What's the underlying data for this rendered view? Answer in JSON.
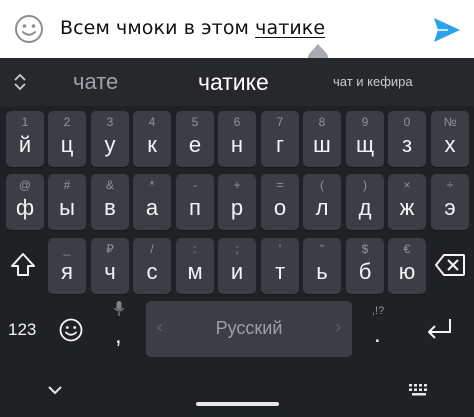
{
  "input_bar": {
    "emoji_icon": "smiley-face-icon",
    "message_plain": "Всем чмоки в этом ",
    "message_underlined": "чатике",
    "send_icon": "send-arrow-icon",
    "accent_color": "#2aa3ef"
  },
  "suggestions": {
    "expand_icon": "expand-chevrons-icon",
    "items": [
      "чате",
      "чатике",
      "чат и кефира"
    ]
  },
  "keyboard": {
    "row1": [
      {
        "hint": "1",
        "label": "й"
      },
      {
        "hint": "2",
        "label": "ц"
      },
      {
        "hint": "3",
        "label": "у"
      },
      {
        "hint": "4",
        "label": "к"
      },
      {
        "hint": "5",
        "label": "е"
      },
      {
        "hint": "6",
        "label": "н"
      },
      {
        "hint": "7",
        "label": "г"
      },
      {
        "hint": "8",
        "label": "ш"
      },
      {
        "hint": "9",
        "label": "щ"
      },
      {
        "hint": "0",
        "label": "з"
      },
      {
        "hint": "№",
        "label": "х"
      }
    ],
    "row2": [
      {
        "hint": "@",
        "label": "ф"
      },
      {
        "hint": "#",
        "label": "ы"
      },
      {
        "hint": "&",
        "label": "в"
      },
      {
        "hint": "*",
        "label": "а"
      },
      {
        "hint": "-",
        "label": "п"
      },
      {
        "hint": "+",
        "label": "р"
      },
      {
        "hint": "=",
        "label": "о"
      },
      {
        "hint": "(",
        "label": "л"
      },
      {
        "hint": ")",
        "label": "д"
      },
      {
        "hint": "×",
        "label": "ж"
      },
      {
        "hint": "÷",
        "label": "э"
      }
    ],
    "row3": [
      {
        "hint": "_",
        "label": "я"
      },
      {
        "hint": "₽",
        "label": "ч"
      },
      {
        "hint": "/",
        "label": "с"
      },
      {
        "hint": ":",
        "label": "м"
      },
      {
        "hint": ";",
        "label": "и"
      },
      {
        "hint": "'",
        "label": "т"
      },
      {
        "hint": "\"",
        "label": "ь"
      },
      {
        "hint": "$",
        "label": "б"
      },
      {
        "hint": "€",
        "label": "ю"
      }
    ],
    "shift_icon": "shift-arrow-icon",
    "backspace_icon": "backspace-icon",
    "numbers_label": "123",
    "emoji_key_icon": "smiley-face-icon",
    "mic_icon": "microphone-icon",
    "comma_label": ",",
    "space_label": "Русский",
    "period_hint": ",!?",
    "period_label": ".",
    "enter_icon": "enter-return-icon"
  },
  "navigation": {
    "hide_icon": "chevron-down-icon",
    "keyboard_icon": "keyboard-switch-icon"
  }
}
